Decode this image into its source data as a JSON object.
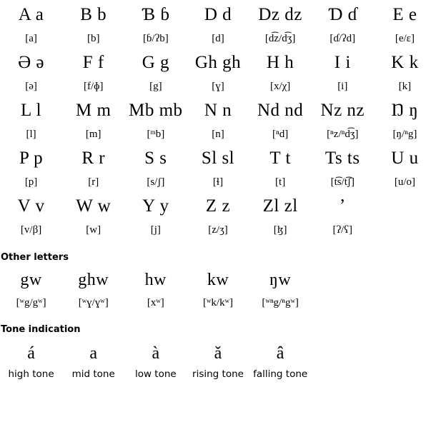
{
  "alphabet": {
    "rows": [
      [
        {
          "letter": "A a",
          "ipa": "[a]"
        },
        {
          "letter": "B b",
          "ipa": "[b]"
        },
        {
          "letter": "Ɓ ɓ",
          "ipa": "[ɓ/ʔb]"
        },
        {
          "letter": "D d",
          "ipa": "[d]"
        },
        {
          "letter": "Dz dz",
          "ipa": "[d͡z/d͡ʒ]"
        },
        {
          "letter": "Ɗ ɗ",
          "ipa": "[ɗ/ʔd]"
        },
        {
          "letter": "E e",
          "ipa": "[e/ɛ]"
        }
      ],
      [
        {
          "letter": "Ə ə",
          "ipa": "[ə]"
        },
        {
          "letter": "F f",
          "ipa": "[f/ɸ]"
        },
        {
          "letter": "G g",
          "ipa": "[g]"
        },
        {
          "letter": "Gh gh",
          "ipa": "[ɣ]"
        },
        {
          "letter": "H h",
          "ipa": "[x/χ]"
        },
        {
          "letter": "I i",
          "ipa": "[i]"
        },
        {
          "letter": "K k",
          "ipa": "[k]"
        }
      ],
      [
        {
          "letter": "L l",
          "ipa": "[l]"
        },
        {
          "letter": "M m",
          "ipa": "[m]"
        },
        {
          "letter": "Mb mb",
          "ipa": "[ᵐb]"
        },
        {
          "letter": "N n",
          "ipa": "[n]"
        },
        {
          "letter": "Nd nd",
          "ipa": "[ⁿd]"
        },
        {
          "letter": "Nz nz",
          "ipa": "[ⁿz/ⁿd͡ʒ]"
        },
        {
          "letter": "Ŋ ŋ",
          "ipa": "[ŋ/ⁿg]"
        }
      ],
      [
        {
          "letter": "P p",
          "ipa": "[p]"
        },
        {
          "letter": "R r",
          "ipa": "[r]"
        },
        {
          "letter": "S s",
          "ipa": "[s/ʃ]"
        },
        {
          "letter": "Sl sl",
          "ipa": "[ɬ]"
        },
        {
          "letter": "T t",
          "ipa": "[t]"
        },
        {
          "letter": "Ts ts",
          "ipa": "[t͡s/t͡ʃ]"
        },
        {
          "letter": "U u",
          "ipa": "[u/o]"
        }
      ],
      [
        {
          "letter": "V v",
          "ipa": "[v/β]"
        },
        {
          "letter": "W w",
          "ipa": "[w]"
        },
        {
          "letter": "Y y",
          "ipa": "[j]"
        },
        {
          "letter": "Z z",
          "ipa": "[z/ʒ]"
        },
        {
          "letter": "Zl zl",
          "ipa": "[ɮ]"
        },
        {
          "letter": "ʼ",
          "ipa": "[ʔ/ʕ]"
        },
        {
          "letter": "",
          "ipa": ""
        }
      ]
    ]
  },
  "other_letters": {
    "heading": "Other letters",
    "items": [
      {
        "letter": "gw",
        "ipa": "[ʷg/gʷ]"
      },
      {
        "letter": "ghw",
        "ipa": "[ʷɣ/ɣʷ]"
      },
      {
        "letter": "hw",
        "ipa": "[xʷ]"
      },
      {
        "letter": "kw",
        "ipa": "[ʷk/kʷ]"
      },
      {
        "letter": "ŋw",
        "ipa": "[ʷⁿg/ⁿgʷ]"
      }
    ]
  },
  "tone_indication": {
    "heading": "Tone indication",
    "items": [
      {
        "mark": "á",
        "label": "high tone"
      },
      {
        "mark": "a",
        "label": "mid tone"
      },
      {
        "mark": "à",
        "label": "low tone"
      },
      {
        "mark": "ǎ",
        "label": "rising tone"
      },
      {
        "mark": "â",
        "label": "falling tone"
      }
    ]
  }
}
